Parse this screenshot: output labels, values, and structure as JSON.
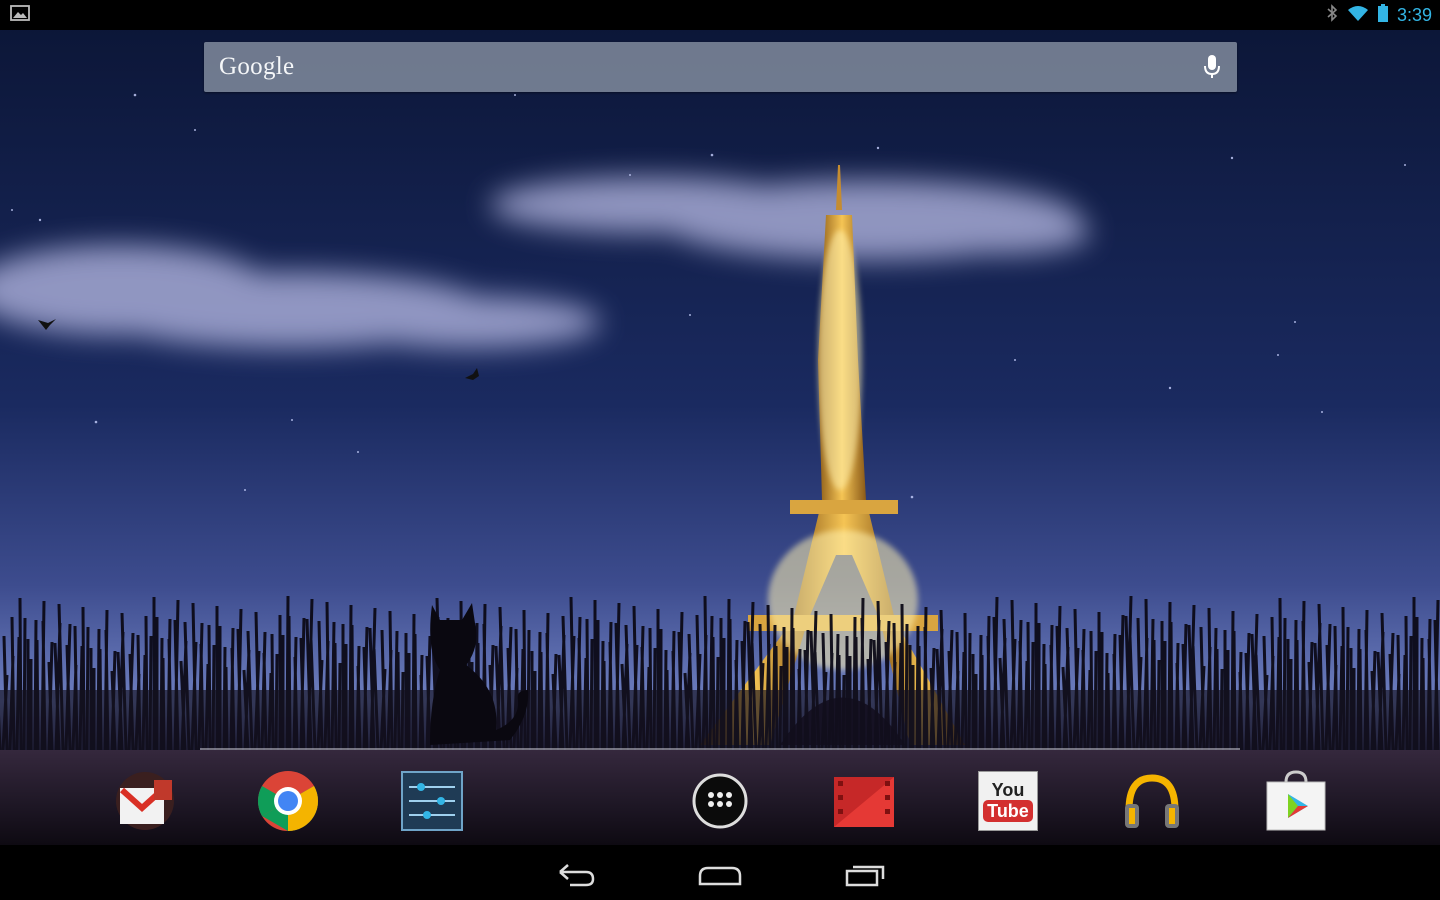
{
  "status_bar": {
    "time": "3:39",
    "icons": [
      "picture-notification-icon",
      "bluetooth-icon",
      "wifi-icon",
      "battery-icon"
    ]
  },
  "search_widget": {
    "logo_text": "Google",
    "mic_icon": "microphone-icon"
  },
  "dock": {
    "apps": [
      {
        "name": "gmail",
        "icon": "gmail-icon"
      },
      {
        "name": "chrome",
        "icon": "chrome-icon"
      },
      {
        "name": "settings",
        "icon": "settings-sliders-icon"
      },
      {
        "name": "app-drawer",
        "icon": "app-drawer-icon"
      },
      {
        "name": "play-movies",
        "icon": "play-movies-icon"
      },
      {
        "name": "youtube",
        "icon": "youtube-icon",
        "label_top": "You",
        "label_bottom": "Tube"
      },
      {
        "name": "play-music",
        "icon": "headphones-icon"
      },
      {
        "name": "play-store",
        "icon": "play-store-icon"
      }
    ]
  },
  "nav_bar": {
    "buttons": [
      "back-icon",
      "home-icon",
      "recents-icon"
    ]
  },
  "colors": {
    "clock": "#33b5e5",
    "sky_top": "#0b1535",
    "sky_horizon": "#6e7fc0",
    "tower_gold": "#e8b040"
  }
}
